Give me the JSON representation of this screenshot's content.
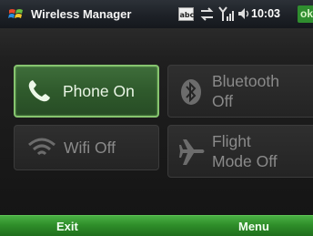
{
  "titlebar": {
    "title": "Wireless Manager",
    "time": "10:03",
    "ok_label": "ok",
    "icons": [
      "windows-logo-icon",
      "input-method-abc-icon",
      "data-connection-icon",
      "signal-strength-icon",
      "volume-icon"
    ]
  },
  "tiles": {
    "phone": {
      "label": "Phone On",
      "icon": "phone-icon",
      "state": "on"
    },
    "bluetooth": {
      "label": "Bluetooth\nOff",
      "icon": "bluetooth-icon",
      "state": "off"
    },
    "wifi": {
      "label": "Wifi Off",
      "icon": "wifi-icon",
      "state": "off"
    },
    "flight": {
      "label": "Flight\nMode Off",
      "icon": "airplane-icon",
      "state": "off"
    }
  },
  "softkeys": {
    "left": "Exit",
    "right": "Menu"
  },
  "colors": {
    "accent_green": "#2f8e2a",
    "active_tile": "#3e6d3a",
    "inactive_text": "#8a8a8a"
  }
}
